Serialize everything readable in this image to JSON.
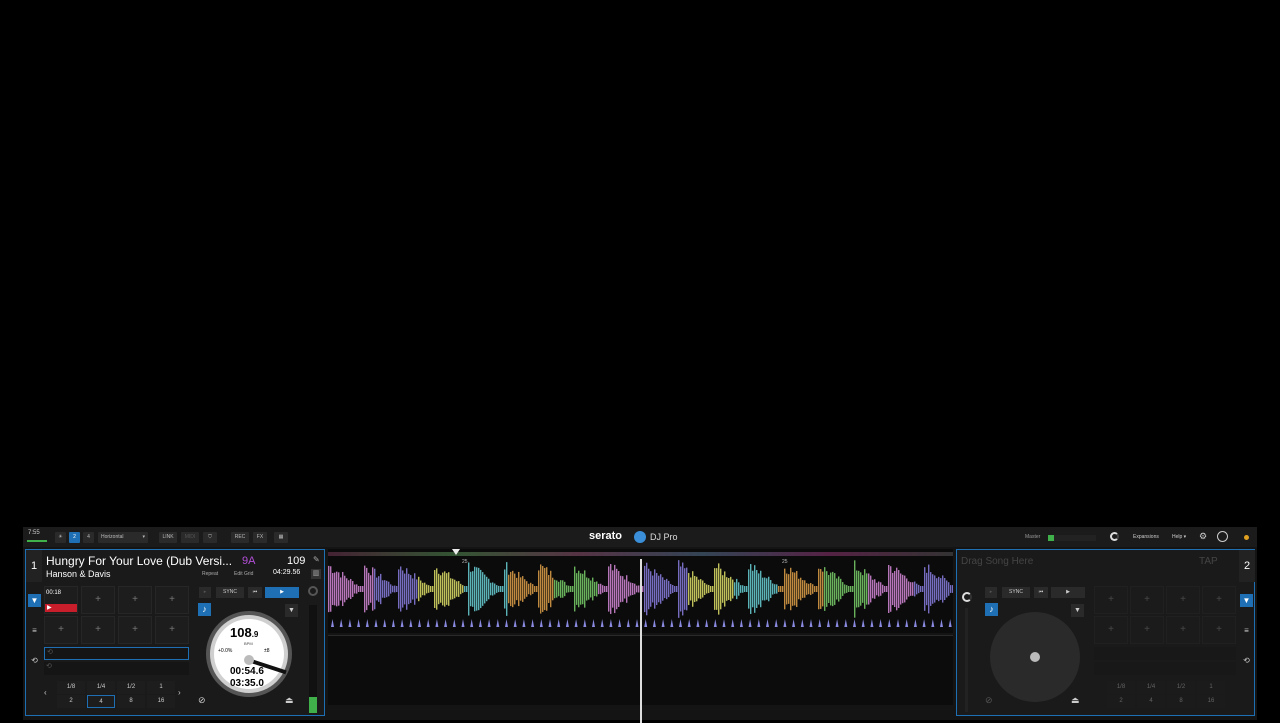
{
  "topbar": {
    "clock": "7:55",
    "deck_2": "2",
    "deck_4": "4",
    "layout": "Horizontal",
    "link": "LINK",
    "midi": "MIDI",
    "rec": "REC",
    "fx": "FX",
    "brand": "serato",
    "product": "DJ Pro",
    "master": "Master",
    "expansions": "Expansions",
    "help": "Help"
  },
  "deck1": {
    "number": "1",
    "title": "Hungry For Your Love (Dub Versi...",
    "key": "9A",
    "bpm": "109",
    "artist": "Hanson & Davis",
    "repeat": "Repeat",
    "edit_grid": "Edit Grid",
    "total_time": "04:29.56",
    "cue_time": "00:18",
    "sync": "SYNC",
    "bpm_big": "108",
    "bpm_dec": ".9",
    "bpm_label": "BPM",
    "pitch": "+0.0%",
    "range": "±8",
    "elapsed": "00:54.6",
    "remaining": "03:35.0",
    "loops_top": [
      "1/8",
      "1/4",
      "1/2",
      "1"
    ],
    "loops_bottom": [
      "2",
      "4",
      "8",
      "16"
    ]
  },
  "deck2": {
    "number": "2",
    "drag": "Drag Song Here",
    "tap": "TAP",
    "sync": "SYNC",
    "loops_top": [
      "1/8",
      "1/4",
      "1/2",
      "1"
    ],
    "loops_bottom": [
      "2",
      "4",
      "8",
      "16"
    ]
  },
  "waveform": {
    "markers": [
      "25",
      "25"
    ]
  },
  "colors": {
    "accent": "#1f6fb4",
    "cue_red": "#c81e2c",
    "key_purple": "#b44fd9"
  }
}
